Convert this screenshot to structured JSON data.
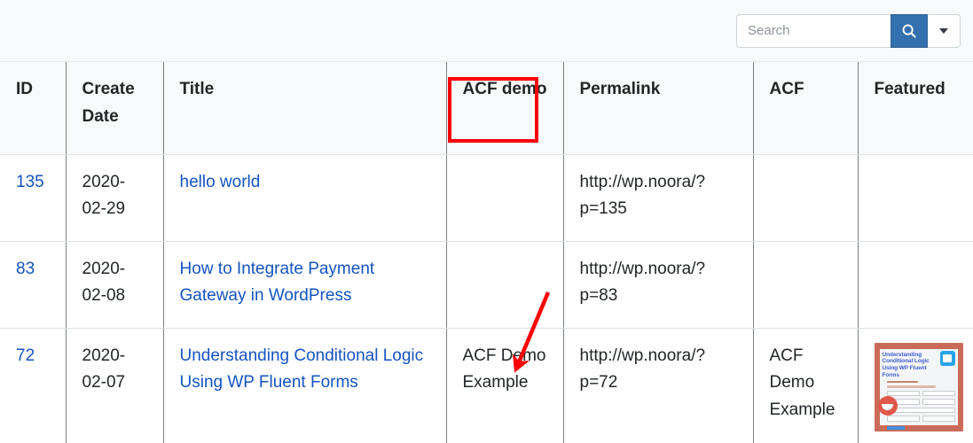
{
  "toolbar": {
    "search": {
      "placeholder": "Search",
      "value": "",
      "icon": "search-icon",
      "button_color": "#3370ad"
    },
    "dropdown": {
      "icon": "caret-down-icon"
    }
  },
  "table": {
    "columns": [
      {
        "key": "id",
        "label": "ID"
      },
      {
        "key": "date",
        "label": "Create Date"
      },
      {
        "key": "title",
        "label": "Title"
      },
      {
        "key": "acf_demo",
        "label": "ACF demo"
      },
      {
        "key": "permalink",
        "label": "Permalink"
      },
      {
        "key": "acf",
        "label": "ACF"
      },
      {
        "key": "featured",
        "label": "Featured"
      }
    ],
    "rows": [
      {
        "id": "135",
        "date": "2020-02-29",
        "title": "hello world",
        "acf_demo": "",
        "permalink": "http://wp.noora/?p=135",
        "acf": "",
        "featured": ""
      },
      {
        "id": "83",
        "date": "2020-02-08",
        "title": "How to Integrate Payment Gateway in WordPress",
        "acf_demo": "",
        "permalink": "http://wp.noora/?p=83",
        "acf": "",
        "featured": ""
      },
      {
        "id": "72",
        "date": "2020-02-07",
        "title": "Understanding Conditional Logic Using WP Fluent Forms",
        "acf_demo": "ACF Demo Example",
        "permalink": "http://wp.noora/?p=72",
        "acf": "ACF Demo Example",
        "featured": "thumbnail-understanding-conditional-logic"
      }
    ]
  },
  "thumbnail": {
    "title": "Understanding Conditional Logic Using WP Fluent Forms"
  },
  "annotations": {
    "highlight_color": "#fa0000",
    "highlight_target": "ACF demo",
    "arrow_target": "ACF Demo Example"
  },
  "colors": {
    "link": "#1553c0",
    "header_bg": "#f8f9fa",
    "border": "#7a7f85",
    "accent": "#3370ad"
  }
}
